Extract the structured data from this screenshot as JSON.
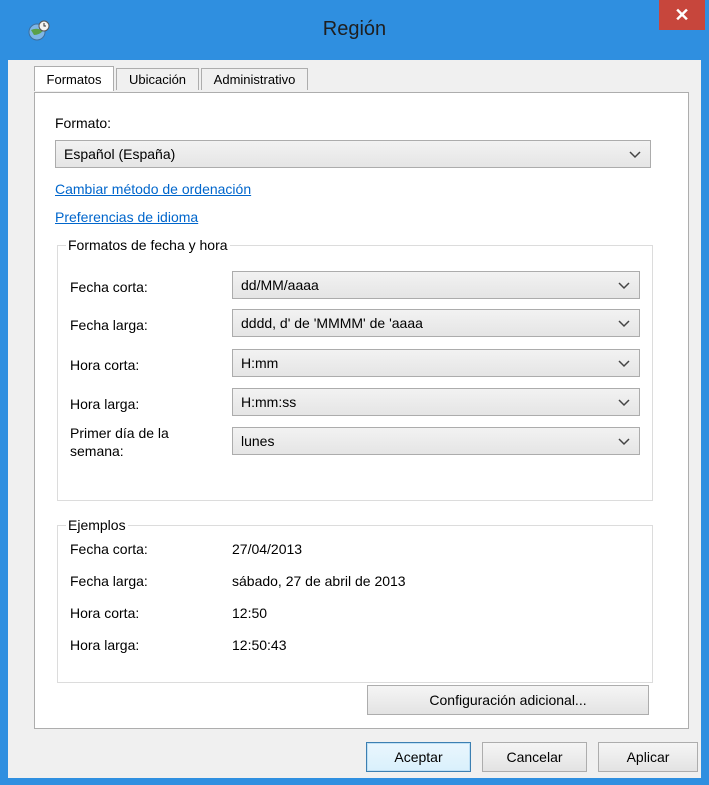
{
  "window": {
    "title": "Región",
    "close_glyph": "✕"
  },
  "tabs": [
    {
      "label": "Formatos",
      "active": true
    },
    {
      "label": "Ubicación",
      "active": false
    },
    {
      "label": "Administrativo",
      "active": false
    }
  ],
  "formatos": {
    "format_label": "Formato:",
    "format_value": "Español (España)",
    "link_sort": "Cambiar método de ordenación",
    "link_language": "Preferencias de idioma",
    "datetime_group": {
      "title": "Formatos de fecha y hora",
      "rows": [
        {
          "label": "Fecha corta:",
          "value": "dd/MM/aaaa"
        },
        {
          "label": "Fecha larga:",
          "value": "dddd, d' de 'MMMM' de 'aaaa"
        },
        {
          "label": "Hora corta:",
          "value": "H:mm"
        },
        {
          "label": "Hora larga:",
          "value": "H:mm:ss"
        },
        {
          "label": "Primer día de la semana:",
          "value": "lunes"
        }
      ]
    },
    "examples_group": {
      "title": "Ejemplos",
      "rows": [
        {
          "label": "Fecha corta:",
          "value": "27/04/2013"
        },
        {
          "label": "Fecha larga:",
          "value": "sábado, 27 de abril de 2013"
        },
        {
          "label": "Hora corta:",
          "value": "12:50"
        },
        {
          "label": "Hora larga:",
          "value": "12:50:43"
        }
      ]
    },
    "additional_settings_button": "Configuración adicional..."
  },
  "footer": {
    "ok": "Aceptar",
    "cancel": "Cancelar",
    "apply": "Aplicar"
  },
  "colors": {
    "title_bar": "#2f8fe0",
    "close_button": "#c7463c",
    "link": "#0066cc"
  },
  "icons": {
    "app": "globe-clock-icon",
    "close": "close-icon",
    "dropdown": "chevron-down-icon"
  }
}
